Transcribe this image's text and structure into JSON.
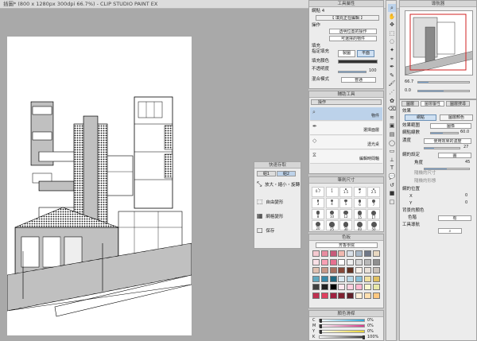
{
  "window": {
    "title": "插圖* (800 x 1280px 300dpi 66.7%) - CLIP STUDIO PAINT EX"
  },
  "tool_property": {
    "header": "工具屬性",
    "subtab": "網點 4",
    "banner": "【 填充正在編輯 】",
    "operation_label": "操作",
    "operation_value1": "透明位置的操作",
    "operation_value2": "可選擇的物件",
    "fill_label": "填充",
    "fill_mode_label": "指定填充",
    "fill_mode_btn1": "製圖",
    "fill_mode_btn2": "平面",
    "fill_color_label": "填充顏色",
    "opacity_label": "不透明度",
    "opacity_value": "100",
    "blend_label": "混合模式",
    "blend_value": "普通"
  },
  "sub_tool": {
    "header": "輔助工具",
    "tab": "操作",
    "items": [
      "物件",
      "選擇面層",
      "透光桌",
      "編輯時間軸"
    ]
  },
  "quick_access": {
    "header": "快速存取",
    "tabs": [
      "組1",
      "組2"
    ],
    "items": [
      "放大・縮小・旋轉",
      "自由變形",
      "網格變形",
      "保存"
    ]
  },
  "brush_size": {
    "header": "筆刷尺寸",
    "sizes": [
      "0.7",
      "1",
      "1.5",
      "2",
      "2.5",
      "3",
      "4",
      "5",
      "6",
      "7",
      "8",
      "10",
      "12",
      "15",
      "17",
      "20",
      "25",
      "30",
      "40",
      "50"
    ]
  },
  "color_set": {
    "header": "色板",
    "name": "芳香學院",
    "colors": [
      "#f5c9d0",
      "#e88ca0",
      "#c85a7a",
      "#f0b8b0",
      "#d9e0e8",
      "#a8b8c8",
      "#707888",
      "#e8d8c0",
      "#f9e0e6",
      "#f8a0b4",
      "#e67090",
      "#ffffff",
      "#f0f0f0",
      "#d8d8d8",
      "#b8b8b8",
      "#909090",
      "#e0c0b0",
      "#c89888",
      "#a87060",
      "#884838",
      "#603020",
      "#f8f0e8",
      "#e8e0d8",
      "#c8c0b8",
      "#60a8c0",
      "#3888a8",
      "#206880",
      "#d8e8f0",
      "#b8d8e8",
      "#88c0d8",
      "#f0e0a0",
      "#e0c060",
      "#404040",
      "#202020",
      "#000000",
      "#ffe8f0",
      "#ffd0e0",
      "#ffb8d0",
      "#f8f8d0",
      "#e8e8a8",
      "#c03050",
      "#e04060",
      "#a02040",
      "#802030",
      "#602028",
      "#fff0d8",
      "#ffe0b0",
      "#ffc880"
    ]
  },
  "color_slider": {
    "header": "顏色滑桿",
    "channels": [
      {
        "label": "C",
        "value": "0%",
        "color": "#2aa7d8",
        "fill": 0
      },
      {
        "label": "M",
        "value": "0%",
        "color": "#d83a8a",
        "fill": 0
      },
      {
        "label": "Y",
        "value": "0%",
        "color": "#e8d430",
        "fill": 0
      },
      {
        "label": "K",
        "value": "100%",
        "color": "#333333",
        "fill": 1
      }
    ]
  },
  "navigator": {
    "header": "導航器",
    "zoom": "66.7",
    "angle": "0.0"
  },
  "layer_property": {
    "header": "圖層屬性",
    "section": "效果",
    "tone_btn": "網點",
    "tone_color_btn": "圖層顏色",
    "effect_range_label": "效果範圍",
    "effect_range_value": "圖像",
    "screen_freq_label": "網點線數",
    "screen_freq_value": "60.0",
    "density_label": "濃度",
    "density_value": "使用效果的濃度",
    "density_num": "27",
    "dot_settings_label": "網的設定",
    "dot_shape": "圓",
    "angle_label": "角度",
    "angle_value": "45",
    "random_size_label": "隨機的尺寸",
    "random_angle_label": "隨機的形態",
    "position_label": "網的位置",
    "x_label": "X",
    "x_value": "0",
    "y_label": "Y",
    "y_value": "0",
    "bg_label": "背景的顏色",
    "color_label": "色階",
    "color_value": "有",
    "nav_label": "工具導航"
  },
  "layer_tabs": [
    "圖層",
    "圖層屬性",
    "圖層搜尋"
  ],
  "toolbar_icons": [
    "zoom-icon",
    "hand-icon",
    "move-icon",
    "select-icon",
    "lasso-icon",
    "magic-wand-icon",
    "eyedropper-icon",
    "pen-icon",
    "pencil-icon",
    "brush-icon",
    "airbrush-icon",
    "decoration-icon",
    "eraser-icon",
    "blend-icon",
    "fill-icon",
    "gradient-icon",
    "figure-icon",
    "frame-icon",
    "ruler-icon",
    "text-icon",
    "balloon-icon",
    "correction-icon",
    "color-fg-icon",
    "color-bg-icon"
  ]
}
